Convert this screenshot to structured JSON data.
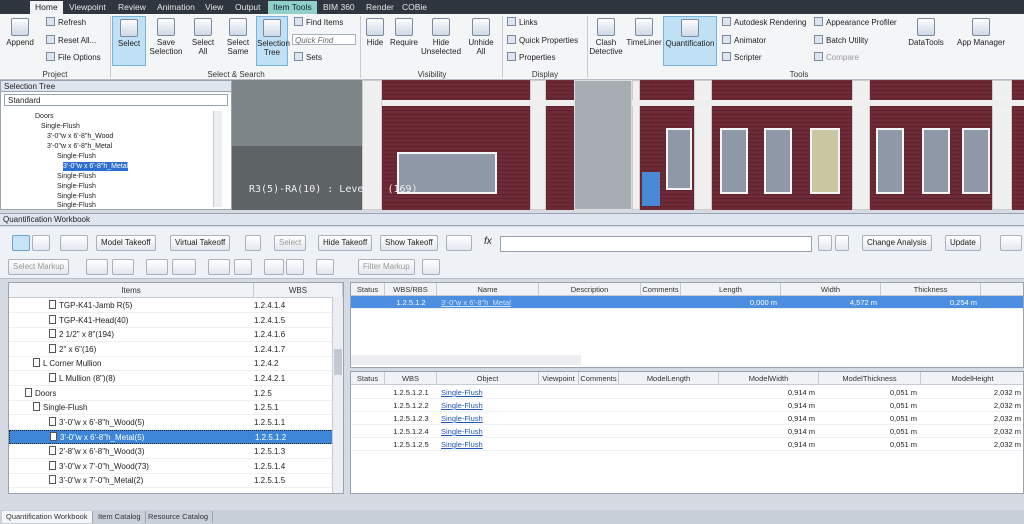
{
  "menubar": {
    "tabs": [
      "Home",
      "Viewpoint",
      "Review",
      "Animation",
      "View",
      "Output",
      "Item Tools",
      "BIM 360",
      "Render",
      "COBie"
    ],
    "active": "Home"
  },
  "ribbon": {
    "project": {
      "append": "Append",
      "refresh": "Refresh",
      "reset_all": "Reset All...",
      "file_options": "File Options",
      "label": "Project"
    },
    "select_search": {
      "select": "Select",
      "save_selection": "Save Selection",
      "select_all": "Select All",
      "select_same": "Select Same",
      "selection_tree": "Selection Tree",
      "find_items": "Find Items",
      "quick_find": "Quick Find",
      "sets": "Sets",
      "label": "Select & Search"
    },
    "visibility": {
      "hide": "Hide",
      "require": "Require",
      "hide_unselected": "Hide Unselected",
      "unhide_all": "Unhide All",
      "label": "Visibility"
    },
    "display": {
      "links": "Links",
      "quick_properties": "Quick Properties",
      "properties": "Properties",
      "label": "Display"
    },
    "tools": {
      "clash_detective": "Clash Detective",
      "timeliner": "TimeLiner",
      "quantification": "Quantification",
      "autodesk_rendering": "Autodesk Rendering",
      "animator": "Animator",
      "scripter": "Scripter",
      "appearance_profiler": "Appearance Profiler",
      "batch_utility": "Batch Utility",
      "compare": "Compare",
      "datatools": "DataTools",
      "app_manager": "App Manager",
      "label": "Tools"
    }
  },
  "selection_tree": {
    "title": "Selection Tree",
    "mode": "Standard",
    "nodes": [
      "Doors",
      "Single-Flush",
      "3'-0\"w x 6'-8\"h_Wood",
      "3'-0\"w x 6'-8\"h_Metal",
      "Single-Flush",
      "3'-0\"w x 6'-8\"h_Metal",
      "Single-Flush",
      "Single-Flush",
      "Single-Flush",
      "Single-Flush"
    ]
  },
  "viewport": {
    "label": "R3(5)-RA(10) : Level 1 (169)"
  },
  "workbook": {
    "title": "Quantification Workbook",
    "toolbar": {
      "model_takeoff": "Model Takeoff",
      "virtual_takeoff": "Virtual Takeoff",
      "select": "Select",
      "hide_takeoff": "Hide Takeoff",
      "show_takeoff": "Show Takeoff",
      "fx": "fx",
      "change_analysis": "Change Analysis",
      "update": "Update",
      "select_markup": "Select Markup",
      "filter_markup": "Filter Markup"
    },
    "items": {
      "headers": [
        "Items",
        "WBS"
      ],
      "rows": [
        {
          "name": "TGP-K41-Jamb R(5)",
          "wbs": "1.2.4.1.4",
          "indent": 40
        },
        {
          "name": "TGP-K41-Head(40)",
          "wbs": "1.2.4.1.5",
          "indent": 40
        },
        {
          "name": "2 1/2\" x 8\"(194)",
          "wbs": "1.2.4.1.6",
          "indent": 40
        },
        {
          "name": "2\" x 6\"(16)",
          "wbs": "1.2.4.1.7",
          "indent": 40
        },
        {
          "name": "L Corner Mullion",
          "wbs": "1.2.4.2",
          "indent": 24
        },
        {
          "name": "L Mullion (8\")(8)",
          "wbs": "1.2.4.2.1",
          "indent": 40
        },
        {
          "name": "Doors",
          "wbs": "1.2.5",
          "indent": 16
        },
        {
          "name": "Single-Flush",
          "wbs": "1.2.5.1",
          "indent": 24
        },
        {
          "name": "3'-0\"w x 6'-8\"h_Wood(5)",
          "wbs": "1.2.5.1.1",
          "indent": 40
        },
        {
          "name": "3'-0\"w x 6'-8\"h_Metal(5)",
          "wbs": "1.2.5.1.2",
          "indent": 40
        },
        {
          "name": "2'-8\"w x 6'-8\"h_Wood(3)",
          "wbs": "1.2.5.1.3",
          "indent": 40
        },
        {
          "name": "3'-0\"w x 7'-0\"h_Wood(73)",
          "wbs": "1.2.5.1.4",
          "indent": 40
        },
        {
          "name": "3'-0\"w x 7'-0\"h_Metal(2)",
          "wbs": "1.2.5.1.5",
          "indent": 40
        }
      ],
      "selected_index": 9
    },
    "grid1": {
      "headers": [
        "Status",
        "WBS/RBS",
        "Name",
        "Description",
        "Comments",
        "Length",
        "Width",
        "Thickness"
      ],
      "row": {
        "wbs": "1.2.5.1.2",
        "name": "3'-0\"w x 6'-8\"h_Metal",
        "length": "0,000 m",
        "width": "4,572 m",
        "thickness": "0,254 m"
      }
    },
    "grid2": {
      "headers": [
        "Status",
        "WBS",
        "Object",
        "Viewpoint",
        "Comments",
        "ModelLength",
        "ModelWidth",
        "ModelThickness",
        "ModelHeight"
      ],
      "rows": [
        {
          "wbs": "1.2.5.1.2.1",
          "object": "Single-Flush",
          "width": "0,914 m",
          "thickness": "0,051 m",
          "height": "2,032 m"
        },
        {
          "wbs": "1.2.5.1.2.2",
          "object": "Single-Flush",
          "width": "0,914 m",
          "thickness": "0,051 m",
          "height": "2,032 m"
        },
        {
          "wbs": "1.2.5.1.2.3",
          "object": "Single-Flush",
          "width": "0,914 m",
          "thickness": "0,051 m",
          "height": "2,032 m"
        },
        {
          "wbs": "1.2.5.1.2.4",
          "object": "Single-Flush",
          "width": "0,914 m",
          "thickness": "0,051 m",
          "height": "2,032 m"
        },
        {
          "wbs": "1.2.5.1.2.5",
          "object": "Single-Flush",
          "width": "0,914 m",
          "thickness": "0,051 m",
          "height": "2,032 m"
        }
      ]
    }
  },
  "bottom_tabs": [
    "Quantification Workbook",
    "Item Catalog",
    "Resource Catalog"
  ]
}
